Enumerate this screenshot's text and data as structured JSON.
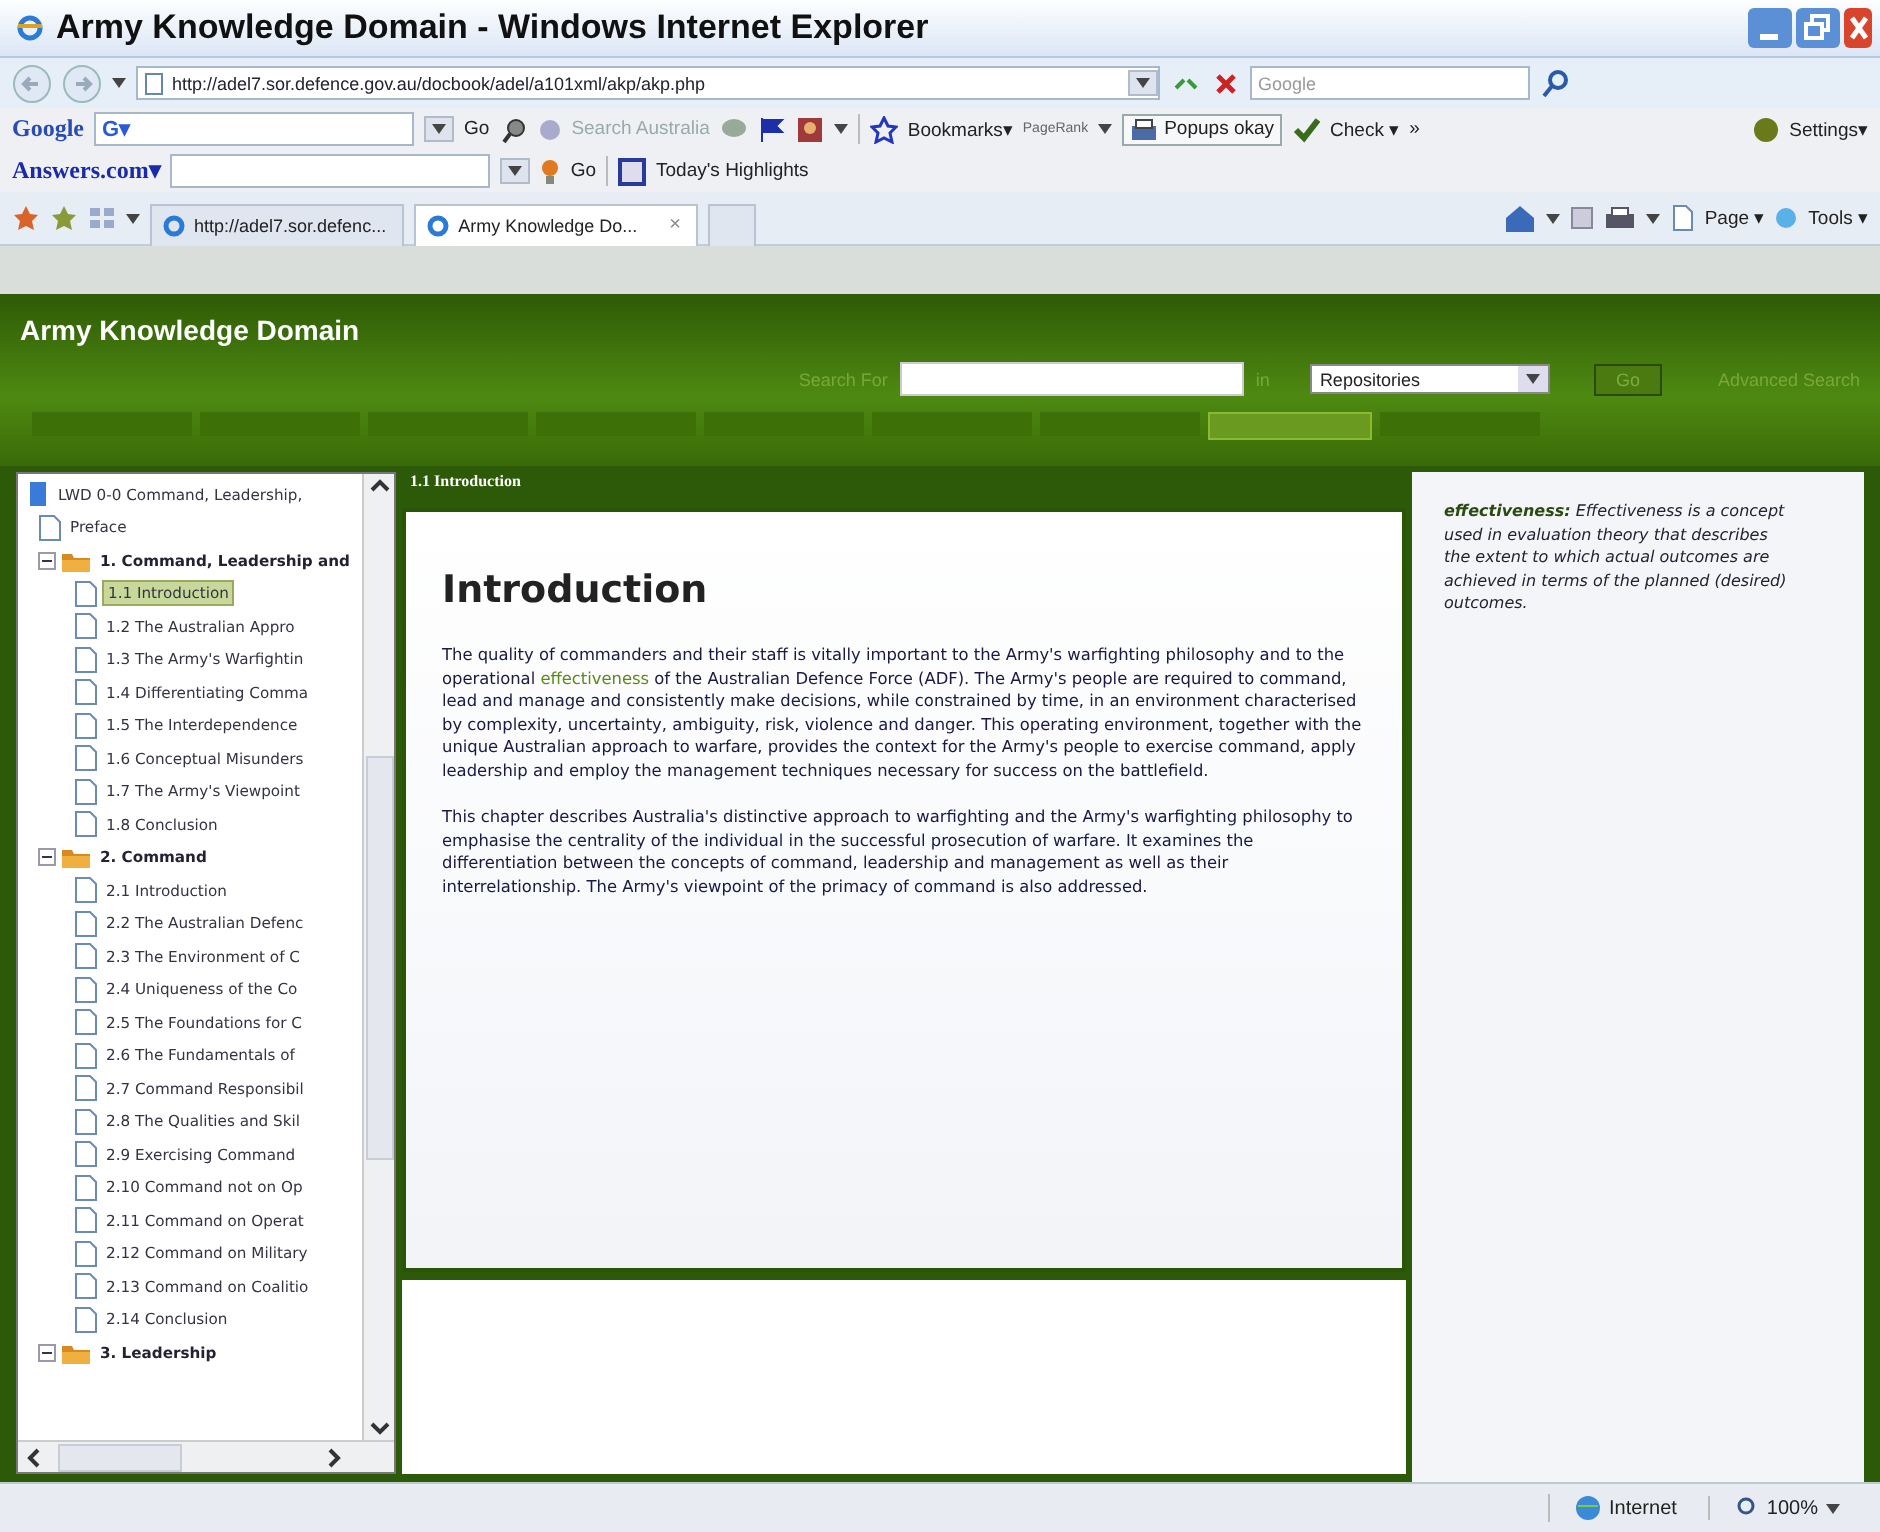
{
  "window": {
    "title": "Army Knowledge Domain - Windows Internet Explorer"
  },
  "address_bar": {
    "url": "http://adel7.sor.defence.gov.au/docbook/adel/a101xml/akp/akp.php",
    "search_placeholder": "Google"
  },
  "google_toolbar": {
    "logo": "Google",
    "field_label": "G▾",
    "go": "Go",
    "search_site": "Search Australia",
    "bookmarks": "Bookmarks▾",
    "pagerank": "PageRank",
    "popups": "Popups okay",
    "check": "Check ▾",
    "more": "»",
    "settings": "Settings▾"
  },
  "answers_toolbar": {
    "logo": "Answers.com▾",
    "go": "Go",
    "highlights": "Today's Highlights"
  },
  "tabs": [
    {
      "label": "http://adel7.sor.defenc...",
      "selected": false
    },
    {
      "label": "Army Knowledge Do...",
      "selected": true,
      "close": "×"
    }
  ],
  "command_bar": {
    "page": "Page ▾",
    "tools": "Tools ▾"
  },
  "site": {
    "title": "Army Knowledge Domain",
    "search_label": "Search For",
    "in_label": "in",
    "scope": "Repositories",
    "go": "Go",
    "advanced": "Advanced Search",
    "nav_tabs": [
      {
        "selected": false
      },
      {
        "selected": false
      },
      {
        "selected": false
      },
      {
        "selected": false
      },
      {
        "selected": false
      },
      {
        "selected": false
      },
      {
        "selected": false
      },
      {
        "selected": true
      },
      {
        "selected": false
      }
    ]
  },
  "tree": {
    "label": "LWD 0-0 Command, Leadership,",
    "children": [
      {
        "label": "Preface",
        "kind": "page",
        "selected": false
      },
      {
        "label": "1. Command, Leadership and",
        "kind": "folder",
        "expanded": true,
        "children": [
          {
            "label": "1.1 Introduction",
            "kind": "page",
            "selected": true
          },
          {
            "label": "1.2 The Australian Appro",
            "kind": "page",
            "selected": false
          },
          {
            "label": "1.3 The Army's Warfightin",
            "kind": "page",
            "selected": false
          },
          {
            "label": "1.4 Differentiating Comma",
            "kind": "page",
            "selected": false
          },
          {
            "label": "1.5 The Interdependence",
            "kind": "page",
            "selected": false
          },
          {
            "label": "1.6 Conceptual Misunders",
            "kind": "page",
            "selected": false
          },
          {
            "label": "1.7 The Army's Viewpoint",
            "kind": "page",
            "selected": false
          },
          {
            "label": "1.8 Conclusion",
            "kind": "page",
            "selected": false
          }
        ]
      },
      {
        "label": "2. Command",
        "kind": "folder",
        "expanded": true,
        "children": [
          {
            "label": "2.1 Introduction",
            "kind": "page",
            "selected": false
          },
          {
            "label": "2.2 The Australian Defenc",
            "kind": "page",
            "selected": false
          },
          {
            "label": "2.3 The Environment of C",
            "kind": "page",
            "selected": false
          },
          {
            "label": "2.4 Uniqueness of the Co",
            "kind": "page",
            "selected": false
          },
          {
            "label": "2.5 The Foundations for C",
            "kind": "page",
            "selected": false
          },
          {
            "label": "2.6 The Fundamentals of",
            "kind": "page",
            "selected": false
          },
          {
            "label": "2.7 Command Responsibil",
            "kind": "page",
            "selected": false
          },
          {
            "label": "2.8 The Qualities and Skil",
            "kind": "page",
            "selected": false
          },
          {
            "label": "2.9 Exercising Command",
            "kind": "page",
            "selected": false
          },
          {
            "label": "2.10 Command not on Op",
            "kind": "page",
            "selected": false
          },
          {
            "label": "2.11 Command on Operat",
            "kind": "page",
            "selected": false
          },
          {
            "label": "2.12 Command on Military",
            "kind": "page",
            "selected": false
          },
          {
            "label": "2.13 Command on Coalitio",
            "kind": "page",
            "selected": false
          },
          {
            "label": "2.14 Conclusion",
            "kind": "page",
            "selected": false
          }
        ]
      },
      {
        "label": "3. Leadership",
        "kind": "folder",
        "expanded": true
      }
    ]
  },
  "content": {
    "header": "1.1 Introduction",
    "heading": "Introduction",
    "paragraphs": [
      [
        {
          "text": "The quality of commanders and their staff is vitally important to the Army's warfighting philosophy and to the operational "
        },
        {
          "text": "effectiveness",
          "kind": "link"
        },
        {
          "text": " of the Australian Defence Force (ADF). The Army's people are required to command, lead and manage and consistently make decisions, while constrained by time, in an environment characterised by complexity, uncertainty, ambiguity, risk, violence and danger. This operating environment, together with the unique Australian approach to warfare, provides the context for the Army's people to exercise command, apply leadership and employ the management techniques necessary for success on the battlefield."
        }
      ],
      [
        {
          "text": "This chapter describes Australia's distinctive approach to warfighting and the Army's warfighting philosophy to emphasise the centrality of the individual in the successful prosecution of warfare. It examines the differentiation between the concepts of command, leadership and management as well as their interrelationship. The Army's viewpoint of the primacy of command is also addressed."
        }
      ]
    ]
  },
  "glossary": {
    "term": "effectiveness:",
    "definition": "Effectiveness is a concept used in evaluation theory that describes the extent to which actual outcomes are achieved in terms of the planned (desired) outcomes."
  },
  "status_bar": {
    "zone": "Internet",
    "zoom": "100%"
  }
}
